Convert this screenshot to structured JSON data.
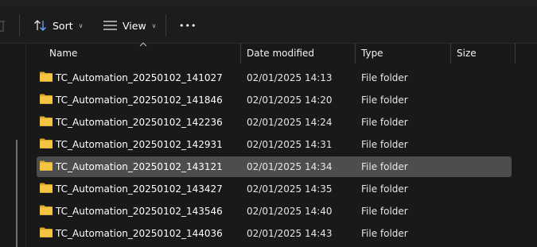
{
  "toolbar": {
    "sort_label": "Sort",
    "view_label": "View",
    "more_label": "•••"
  },
  "columns": {
    "name": "Name",
    "date_modified": "Date modified",
    "type": "Type",
    "size": "Size"
  },
  "files": [
    {
      "name": "TC_Automation_20250102_141027",
      "date": "02/01/2025 14:13",
      "type": "File folder",
      "selected": false
    },
    {
      "name": "TC_Automation_20250102_141846",
      "date": "02/01/2025 14:20",
      "type": "File folder",
      "selected": false
    },
    {
      "name": "TC_Automation_20250102_142236",
      "date": "02/01/2025 14:24",
      "type": "File folder",
      "selected": false
    },
    {
      "name": "TC_Automation_20250102_142931",
      "date": "02/01/2025 14:31",
      "type": "File folder",
      "selected": false
    },
    {
      "name": "TC_Automation_20250102_143121",
      "date": "02/01/2025 14:34",
      "type": "File folder",
      "selected": true
    },
    {
      "name": "TC_Automation_20250102_143427",
      "date": "02/01/2025 14:35",
      "type": "File folder",
      "selected": false
    },
    {
      "name": "TC_Automation_20250102_143546",
      "date": "02/01/2025 14:40",
      "type": "File folder",
      "selected": false
    },
    {
      "name": "TC_Automation_20250102_144036",
      "date": "02/01/2025 14:43",
      "type": "File folder",
      "selected": false
    }
  ],
  "colors": {
    "background": "#191919",
    "selected_row": "#4d4d4d",
    "folder_yellow": "#f4c542",
    "folder_yellow_dark": "#dca92a"
  }
}
